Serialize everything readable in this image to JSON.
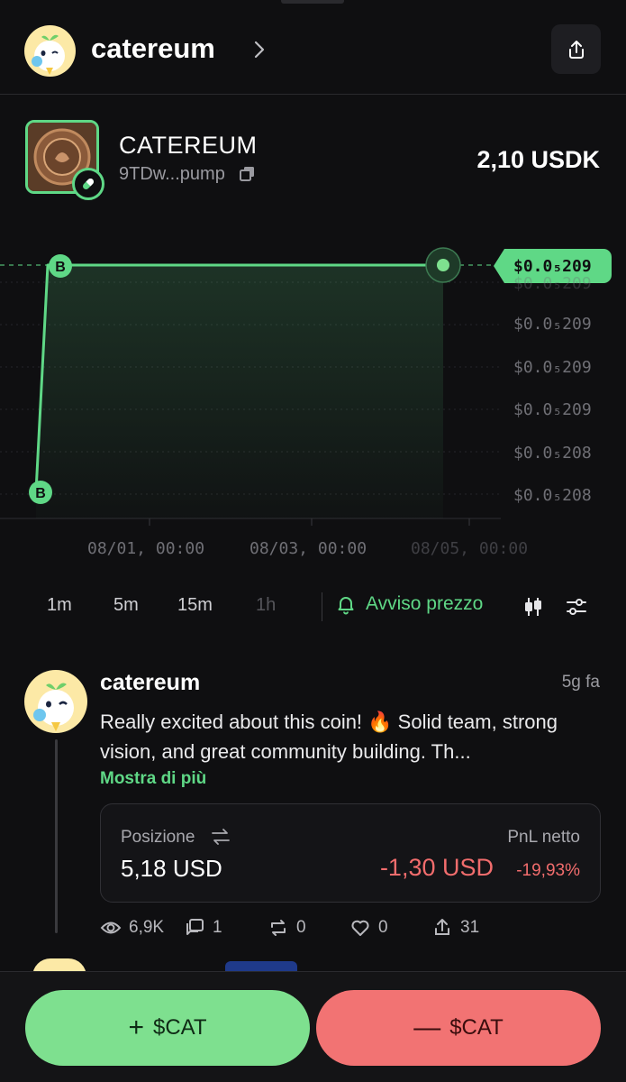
{
  "header": {
    "name": "catereum"
  },
  "token": {
    "name": "CATEREUM",
    "address": "9TDw...pump",
    "price": "2,10 USDK"
  },
  "chart_data": {
    "type": "line",
    "current_price_tag": "$0.0₅209",
    "y_tick_labels": [
      "$0.0₅209",
      "$0.0₅209",
      "$0.0₅209",
      "$0.0₅209",
      "$0.0₅208",
      "$0.0₅208"
    ],
    "x_tick_labels": [
      "08/01, 00:00",
      "08/03, 00:00",
      "08/05, 00:00"
    ],
    "series": [
      {
        "x": [
          "08/01, 00:00",
          "08/01, 00:00",
          "08/05, 00:00"
        ],
        "y": [
          2.08e-05,
          2.09e-05,
          2.09e-05
        ]
      }
    ],
    "markers": [
      {
        "label": "B",
        "index": 0
      },
      {
        "label": "B",
        "index": 1
      }
    ],
    "grid": true,
    "accent": "#5fd886"
  },
  "timeframes": [
    {
      "label": "1m"
    },
    {
      "label": "5m"
    },
    {
      "label": "15m"
    },
    {
      "label": "1h"
    }
  ],
  "alert_label": "Avviso prezzo",
  "post": {
    "user": "catereum",
    "time": "5g fa",
    "text": "Really excited about this coin! 🔥 Solid team, strong vision, and great community building. Th...",
    "more": "Mostra di più",
    "position_label": "Posizione",
    "position_value": "5,18 USD",
    "pnl_label": "PnL netto",
    "pnl_value": "-1,30 USD",
    "pnl_pct": "-19,93%",
    "stats": {
      "views": "6,9K",
      "comments": "1",
      "reposts": "0",
      "likes": "0",
      "shares": "31"
    }
  },
  "actions": {
    "buy_label": "$CAT",
    "sell_label": "$CAT"
  },
  "colors": {
    "accent_green": "#5fd886",
    "negative_red": "#f26d6d",
    "buy_button": "#7ee08f",
    "sell_button": "#f27373",
    "background": "#0f0f11"
  }
}
